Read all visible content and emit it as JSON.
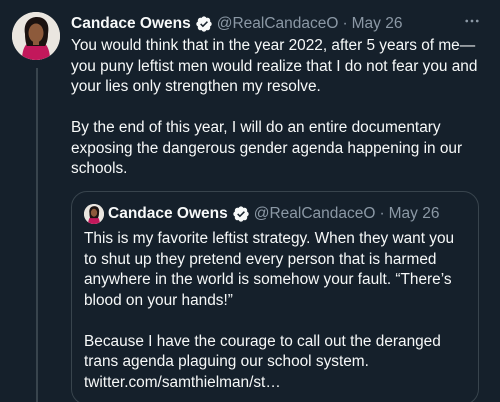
{
  "tweet": {
    "author_name": "Candace Owens",
    "handle": "@RealCandaceO",
    "separator": "·",
    "date": "May 26",
    "more_icon": "more-horizontal-icon",
    "verified_icon": "verified-badge-icon",
    "paragraph_1": "You would think that in the year 2022, after 5 years of me— you puny leftist men would realize that I do not fear you and your lies only strengthen my resolve.",
    "paragraph_2": "By the end of this year, I will do an entire documentary exposing the dangerous gender agenda happening in our schools."
  },
  "quoted_tweet": {
    "author_name": "Candace Owens",
    "handle": "@RealCandaceO",
    "separator": "·",
    "date": "May 26",
    "paragraph_1": "This is my favorite leftist strategy. When they want you to shut up they pretend every person that is harmed anywhere in the world is somehow your fault. “There’s blood on your hands!”",
    "paragraph_2": "Because I have the courage to call out the deranged trans agenda plaguing our school system.",
    "link_text": "twitter.com/samthielman/st…"
  },
  "colors": {
    "background": "#15202b",
    "text": "#f7f9f9",
    "secondary_text": "#8b98a5",
    "border": "#38444d",
    "verified_badge": "#1d9bf0"
  }
}
